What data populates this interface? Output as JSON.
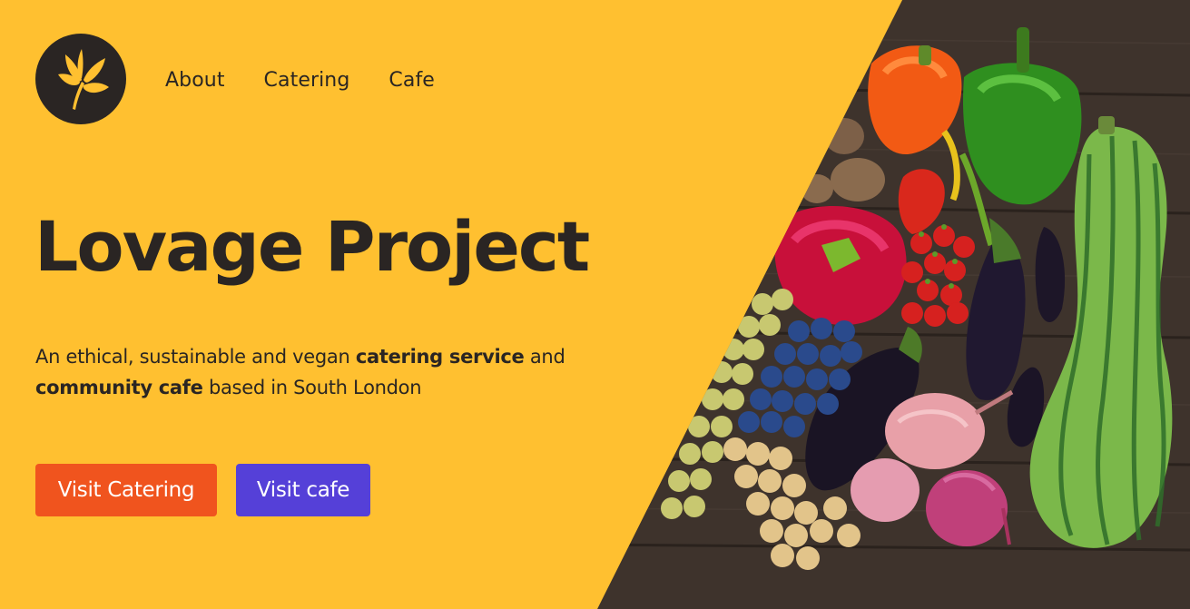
{
  "nav": {
    "items": [
      {
        "label": "About"
      },
      {
        "label": "Catering"
      },
      {
        "label": "Cafe"
      }
    ]
  },
  "hero": {
    "title": "Lovage Project",
    "tagline": {
      "part1": "An ethical, sustainable and vegan ",
      "bold1": "catering service",
      "part2": " and ",
      "bold2": "community cafe",
      "part3": " based in South London"
    },
    "buttons": {
      "catering": "Visit Catering",
      "cafe": "Visit cafe"
    }
  },
  "colors": {
    "background": "#ffc030",
    "text": "#2a2523",
    "catering_button": "#f0541e",
    "cafe_button": "#5540d8",
    "logo_circle": "#2a2523",
    "logo_leaf": "#ffc030"
  },
  "icons": {
    "logo": "lovage-leaf-icon"
  }
}
